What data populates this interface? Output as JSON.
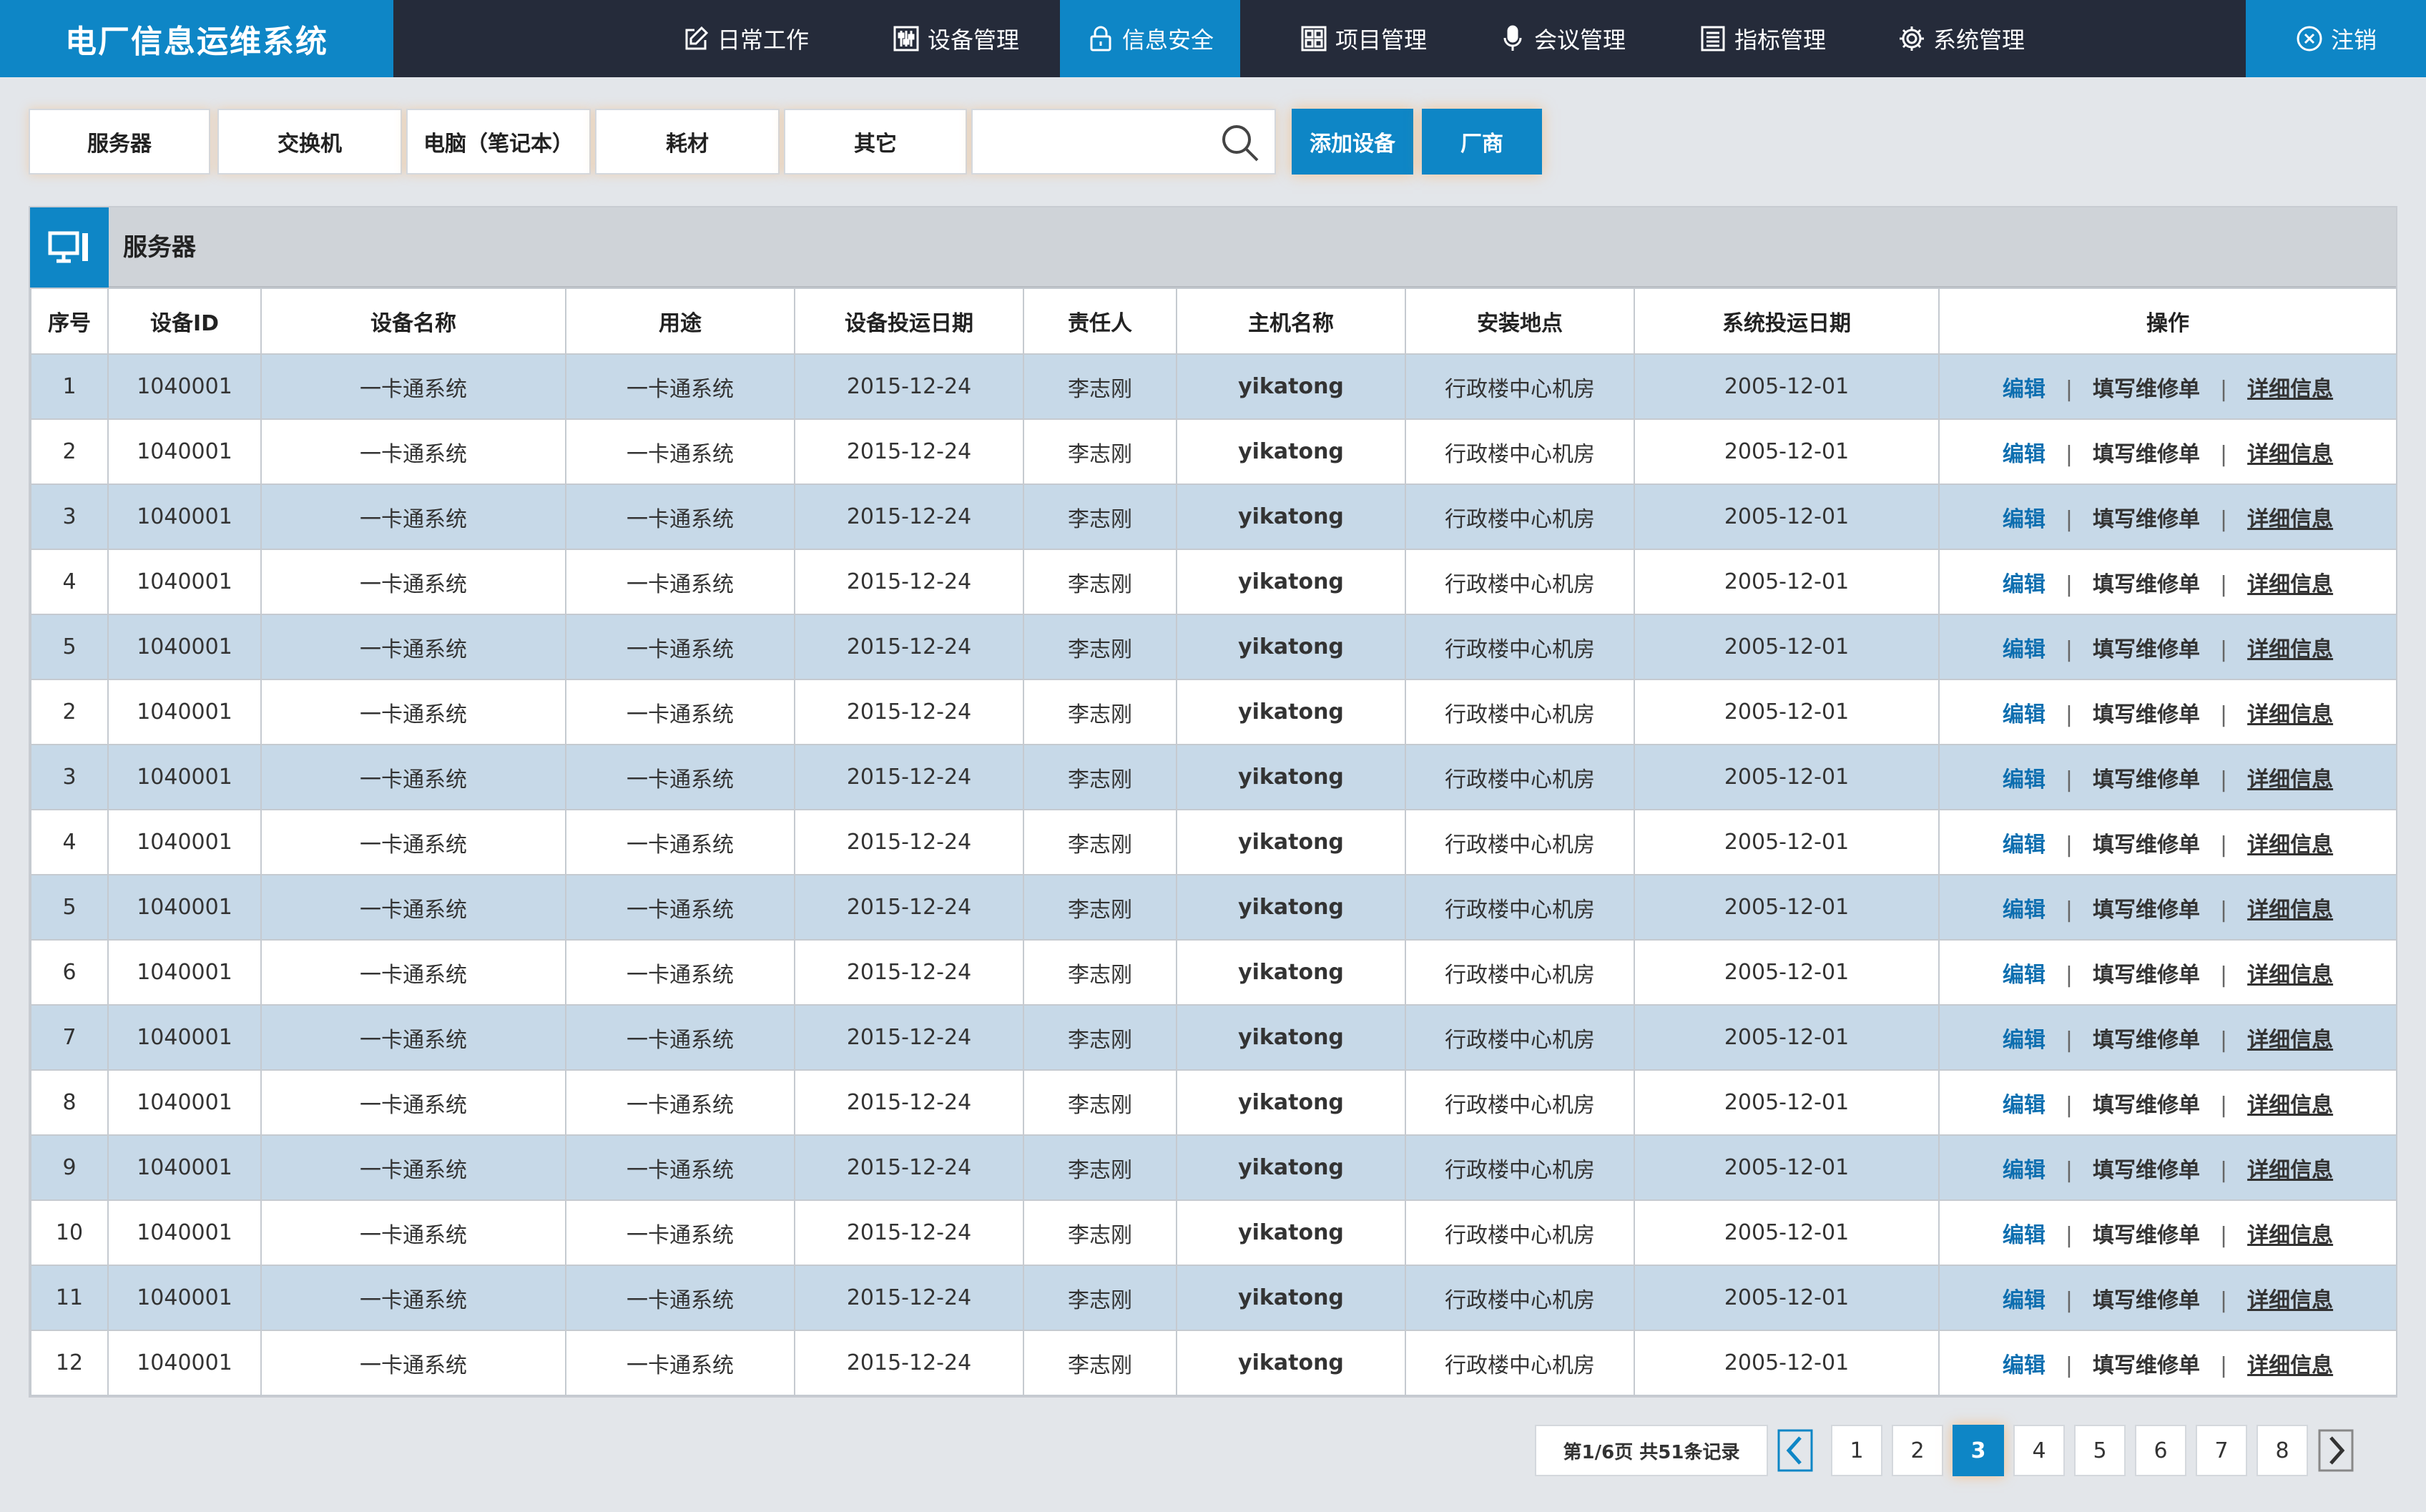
{
  "app": {
    "title": "电厂信息运维系统"
  },
  "nav": {
    "items": [
      {
        "label": "日常工作",
        "icon": "edit-icon"
      },
      {
        "label": "设备管理",
        "icon": "sliders-icon"
      },
      {
        "label": "信息安全",
        "icon": "lock-icon",
        "active": true
      },
      {
        "label": "项目管理",
        "icon": "grid-icon"
      },
      {
        "label": "会议管理",
        "icon": "microphone-icon"
      },
      {
        "label": "指标管理",
        "icon": "list-icon"
      },
      {
        "label": "系统管理",
        "icon": "gear-icon"
      }
    ],
    "logout_label": "注销"
  },
  "filters": [
    "服务器",
    "交换机",
    "电脑（笔记本）",
    "耗材",
    "其它"
  ],
  "search": {
    "value": "",
    "placeholder": ""
  },
  "actions": {
    "add_device": "添加设备",
    "vendor": "厂商"
  },
  "panel": {
    "title": "服务器"
  },
  "table": {
    "columns": [
      "序号",
      "设备ID",
      "设备名称",
      "用途",
      "设备投运日期",
      "责任人",
      "主机名称",
      "安装地点",
      "系统投运日期",
      "操作"
    ],
    "rows": [
      [
        "1",
        "1040001",
        "一卡通系统",
        "一卡通系统",
        "2015-12-24",
        "李志刚",
        "yikatong",
        "行政楼中心机房",
        "2005-12-01"
      ],
      [
        "2",
        "1040001",
        "一卡通系统",
        "一卡通系统",
        "2015-12-24",
        "李志刚",
        "yikatong",
        "行政楼中心机房",
        "2005-12-01"
      ],
      [
        "3",
        "1040001",
        "一卡通系统",
        "一卡通系统",
        "2015-12-24",
        "李志刚",
        "yikatong",
        "行政楼中心机房",
        "2005-12-01"
      ],
      [
        "4",
        "1040001",
        "一卡通系统",
        "一卡通系统",
        "2015-12-24",
        "李志刚",
        "yikatong",
        "行政楼中心机房",
        "2005-12-01"
      ],
      [
        "5",
        "1040001",
        "一卡通系统",
        "一卡通系统",
        "2015-12-24",
        "李志刚",
        "yikatong",
        "行政楼中心机房",
        "2005-12-01"
      ],
      [
        "2",
        "1040001",
        "一卡通系统",
        "一卡通系统",
        "2015-12-24",
        "李志刚",
        "yikatong",
        "行政楼中心机房",
        "2005-12-01"
      ],
      [
        "3",
        "1040001",
        "一卡通系统",
        "一卡通系统",
        "2015-12-24",
        "李志刚",
        "yikatong",
        "行政楼中心机房",
        "2005-12-01"
      ],
      [
        "4",
        "1040001",
        "一卡通系统",
        "一卡通系统",
        "2015-12-24",
        "李志刚",
        "yikatong",
        "行政楼中心机房",
        "2005-12-01"
      ],
      [
        "5",
        "1040001",
        "一卡通系统",
        "一卡通系统",
        "2015-12-24",
        "李志刚",
        "yikatong",
        "行政楼中心机房",
        "2005-12-01"
      ],
      [
        "6",
        "1040001",
        "一卡通系统",
        "一卡通系统",
        "2015-12-24",
        "李志刚",
        "yikatong",
        "行政楼中心机房",
        "2005-12-01"
      ],
      [
        "7",
        "1040001",
        "一卡通系统",
        "一卡通系统",
        "2015-12-24",
        "李志刚",
        "yikatong",
        "行政楼中心机房",
        "2005-12-01"
      ],
      [
        "8",
        "1040001",
        "一卡通系统",
        "一卡通系统",
        "2015-12-24",
        "李志刚",
        "yikatong",
        "行政楼中心机房",
        "2005-12-01"
      ],
      [
        "9",
        "1040001",
        "一卡通系统",
        "一卡通系统",
        "2015-12-24",
        "李志刚",
        "yikatong",
        "行政楼中心机房",
        "2005-12-01"
      ],
      [
        "10",
        "1040001",
        "一卡通系统",
        "一卡通系统",
        "2015-12-24",
        "李志刚",
        "yikatong",
        "行政楼中心机房",
        "2005-12-01"
      ],
      [
        "11",
        "1040001",
        "一卡通系统",
        "一卡通系统",
        "2015-12-24",
        "李志刚",
        "yikatong",
        "行政楼中心机房",
        "2005-12-01"
      ],
      [
        "12",
        "1040001",
        "一卡通系统",
        "一卡通系统",
        "2015-12-24",
        "李志刚",
        "yikatong",
        "行政楼中心机房",
        "2005-12-01"
      ]
    ],
    "row_actions": {
      "edit": "编辑",
      "fill_repair": "填写维修单",
      "detail": "详细信息",
      "separator": "|"
    }
  },
  "pagination": {
    "info": "第1/6页 共51条记录",
    "pages": [
      "1",
      "2",
      "3",
      "4",
      "5",
      "6",
      "7",
      "8"
    ],
    "current": "3"
  },
  "colors": {
    "accent": "#0e86c6",
    "topbar": "#252b3a",
    "row_alt": "#c7d9e8",
    "background": "#e3e6ea"
  }
}
